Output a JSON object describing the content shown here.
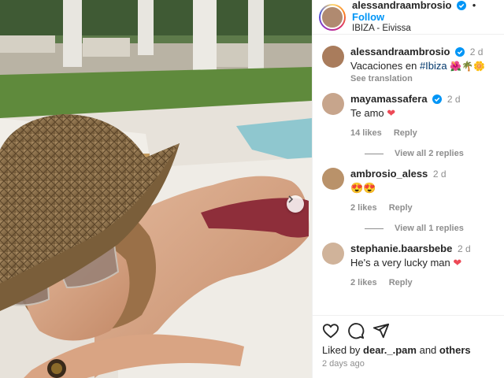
{
  "post": {
    "username": "alessandraambrosio",
    "follow_label": "Follow",
    "separator": "•",
    "location": "IBIZA - Eivissa",
    "next_icon": "chevron-right-icon"
  },
  "caption": {
    "username": "alessandraambrosio",
    "time": "2 d",
    "text_prefix": "Vacaciones en ",
    "hashtag": "#Ibiza",
    "emojis": "🌺🌴🌼",
    "see_translation": "See translation"
  },
  "comments": [
    {
      "username": "mayamassafera",
      "time": "2 d",
      "text": "Te amo",
      "emoji": "❤",
      "likes": "14 likes",
      "reply": "Reply",
      "view_replies": "View all 2 replies"
    },
    {
      "username": "ambrosio_aless",
      "time": "2 d",
      "text": "",
      "emoji": "😍😍",
      "likes": "2 likes",
      "reply": "Reply",
      "view_replies": "View all 1 replies"
    },
    {
      "username": "stephanie.baarsbebe",
      "time": "2 d",
      "text": "He's a very lucky man",
      "emoji": "❤",
      "likes": "2 likes",
      "reply": "Reply"
    }
  ],
  "footer": {
    "liked_prefix": "Liked by ",
    "liked_user": "dear._.pam",
    "liked_and": " and ",
    "liked_others": "others",
    "ago": "2 days ago"
  },
  "colors": {
    "accent": "#0095f6",
    "heart": "#ed4956",
    "muted": "#8e8e8e",
    "hashtag": "#00376b"
  }
}
